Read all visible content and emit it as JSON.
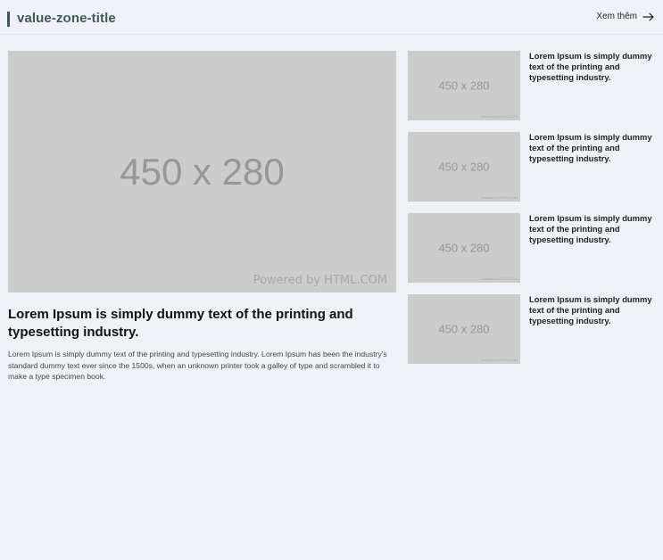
{
  "header": {
    "title": "value-zone-title",
    "see_more_label": "Xem thêm"
  },
  "main_article": {
    "image_label": "450 x 280",
    "image_watermark": "Powered by HTML.COM",
    "heading": "Lorem Ipsum is simply dummy text of the printing and typesetting industry.",
    "description": "Lorem Ipsum is simply dummy text of the printing and typesetting industry. Lorem Ipsum has been the industry's standard dummy text ever since the 1500s, when an unknown printer took a galley of type and scrambled it to make a type specimen book."
  },
  "side_articles": [
    {
      "image_label": "450 x 280",
      "image_watermark": "Powered by HTML.COM",
      "heading": "Lorem Ipsum is simply dummy text of the printing and typesetting industry."
    },
    {
      "image_label": "450 x 280",
      "image_watermark": "Powered by HTML.COM",
      "heading": "Lorem Ipsum is simply dummy text of the printing and typesetting industry."
    },
    {
      "image_label": "450 x 280",
      "image_watermark": "Powered by HTML.COM",
      "heading": "Lorem Ipsum is simply dummy text of the printing and typesetting industry."
    },
    {
      "image_label": "450 x 280",
      "image_watermark": "Powered by HTML.COM",
      "heading": "Lorem Ipsum is simply dummy text of the printing and typesetting industry."
    }
  ],
  "colors": {
    "page_background": "#eef2f6",
    "title_accent": "#3d5a55",
    "placeholder_background": "#cccccc",
    "placeholder_text": "#979797"
  },
  "icons": {
    "see_more": "arrow-right-icon"
  }
}
